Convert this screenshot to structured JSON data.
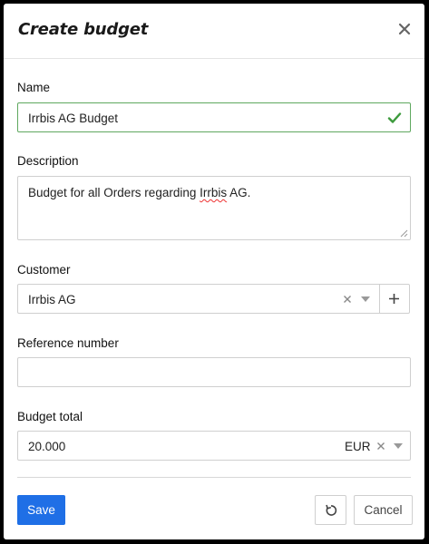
{
  "dialog": {
    "title": "Create budget",
    "close_icon": "close-icon"
  },
  "form": {
    "name": {
      "label": "Name",
      "value": "Irrbis AG Budget",
      "valid_icon": "checkmark-icon",
      "valid_color": "#5fa85f"
    },
    "description": {
      "label": "Description",
      "value_before": "Budget for all Orders regarding ",
      "value_misspelled": "Irrbis",
      "value_after": " AG."
    },
    "customer": {
      "label": "Customer",
      "selected": "Irrbis AG",
      "clear_icon": "clear-x-icon",
      "dropdown_icon": "chevron-down-icon",
      "add_icon": "plus-icon"
    },
    "reference_number": {
      "label": "Reference number",
      "value": "",
      "placeholder": ""
    },
    "budget_total": {
      "label": "Budget total",
      "amount": "20.000",
      "currency": "EUR",
      "clear_icon": "clear-x-icon",
      "dropdown_icon": "chevron-down-icon"
    }
  },
  "footer": {
    "save_label": "Save",
    "reset_icon": "reset-icon",
    "cancel_label": "Cancel"
  },
  "colors": {
    "primary": "#1f6fe6",
    "valid": "#5fa85f",
    "border": "#cfcfcf"
  }
}
